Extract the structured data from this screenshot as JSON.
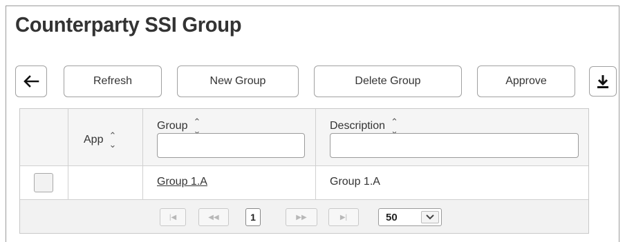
{
  "page": {
    "title": "Counterparty SSI Group"
  },
  "toolbar": {
    "back_icon": "arrow-left-icon",
    "refresh_label": "Refresh",
    "new_group_label": "New Group",
    "delete_group_label": "Delete Group",
    "approve_label": "Approve",
    "download_icon": "download-icon"
  },
  "grid": {
    "columns": [
      {
        "label": "",
        "sortable": false
      },
      {
        "label": "App",
        "sortable": true
      },
      {
        "label": "Group",
        "sortable": true,
        "filter_value": ""
      },
      {
        "label": "Description",
        "sortable": true,
        "filter_value": ""
      }
    ],
    "rows": [
      {
        "checked": false,
        "app": "",
        "group": "Group 1.A",
        "description": "Group 1.A"
      }
    ],
    "sort_icon": "sort-updown-icon"
  },
  "pager": {
    "current_page": "1",
    "page_size": "50",
    "first_icon": "first-page-icon",
    "prev_icon": "prev-page-icon",
    "next_icon": "next-page-icon",
    "last_icon": "last-page-icon"
  }
}
